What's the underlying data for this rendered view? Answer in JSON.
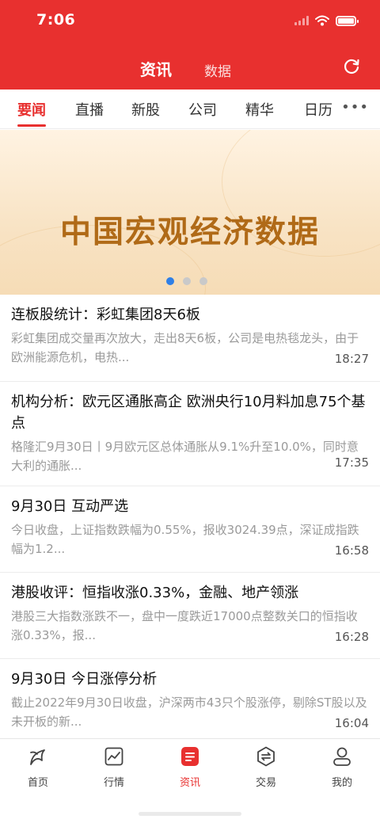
{
  "status_bar": {
    "time": "7:06"
  },
  "header": {
    "tabs": [
      {
        "label": "资讯",
        "active": true
      },
      {
        "label": "数据",
        "active": false
      }
    ],
    "refresh_icon": "refresh-icon",
    "brand_color": "#e8302f"
  },
  "channels": {
    "items": [
      {
        "label": "要闻",
        "active": true
      },
      {
        "label": "直播"
      },
      {
        "label": "新股"
      },
      {
        "label": "公司"
      },
      {
        "label": "精华"
      },
      {
        "label": "日历"
      }
    ],
    "more_label": "•••"
  },
  "banner": {
    "title": "中国宏观经济数据",
    "page_count": 3,
    "active_page": 1
  },
  "news": [
    {
      "title": "连板股统计：彩虹集团8天6板",
      "desc": "彩虹集团成交量再次放大，走出8天6板，公司是电热毯龙头，由于欧洲能源危机，电热...",
      "time": "18:27"
    },
    {
      "title": "机构分析：欧元区通胀高企 欧洲央行10月料加息75个基点",
      "desc": "格隆汇9月30日丨9月欧元区总体通胀从9.1%升至10.0%，同时意大利的通胀...",
      "time": "17:35"
    },
    {
      "title": "9月30日 互动严选",
      "desc": "今日收盘，上证指数跌幅为0.55%，报收3024.39点，深证成指跌幅为1.2...",
      "time": "16:58"
    },
    {
      "title": "港股收评：恒指收涨0.33%，金融、地产领涨",
      "desc": "港股三大指数涨跌不一，盘中一度跌近17000点整数关口的恒指收涨0.33%，报...",
      "time": "16:28"
    },
    {
      "title": "9月30日 今日涨停分析",
      "desc": "截止2022年9月30日收盘，沪深两市43只个股涨停，剔除ST股以及未开板的新...",
      "time": "16:04"
    }
  ],
  "bottom_nav": [
    {
      "label": "首页",
      "icon": "home-icon"
    },
    {
      "label": "行情",
      "icon": "market-chart-icon"
    },
    {
      "label": "资讯",
      "icon": "news-icon",
      "active": true
    },
    {
      "label": "交易",
      "icon": "trade-icon"
    },
    {
      "label": "我的",
      "icon": "profile-icon"
    }
  ]
}
